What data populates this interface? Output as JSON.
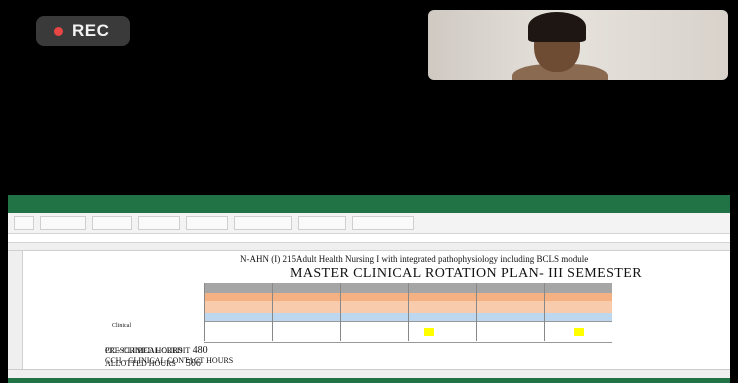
{
  "recorder": {
    "label": "REC",
    "dot_color": "#e84545"
  },
  "excel": {
    "sheet": {
      "title_line1": "N-AHN (I) 215Adult Health Nursing I with integrated pathophysiology including BCLS module",
      "title_line2": "MASTER CLINICAL ROTATION PLAN- III SEMESTER",
      "row_label_clinical": "Clinical",
      "legend": {
        "cc": "CC - CLINICAL CREDIT",
        "cch": "CCH - CLINICAL CONTACT HOURS",
        "prescribed_label": "PRESCRIBED HOURS",
        "prescribed_value": "480",
        "allotted_label": "ALLOTTED HOURS",
        "allotted_value": "506"
      }
    },
    "colors": {
      "accent": "#217346",
      "header_gray": "#a6a6a6",
      "week_orange": "#f4b183",
      "days_orange": "#f8cbad",
      "blue": "#bdd7ee",
      "highlight": "#ffff00"
    }
  }
}
